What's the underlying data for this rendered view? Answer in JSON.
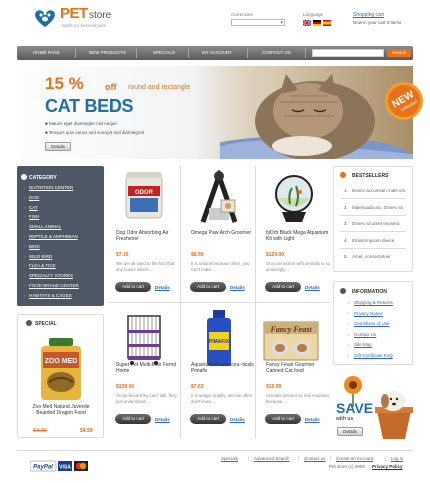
{
  "brand": {
    "pet": "PET",
    "store": "store",
    "tagline": "stuffs for beloved pets"
  },
  "header": {
    "currency_label": "Currencies",
    "currency_value": "",
    "language_label": "Language",
    "cart_title": "Shopping cart",
    "cart_text": "Now in your cart 0 items"
  },
  "nav": {
    "items": [
      "Home Page",
      "New Products",
      "Specials",
      "My Account",
      "Contact Us"
    ],
    "search_label": "Search",
    "search_placeholder": ""
  },
  "banner": {
    "percent": "15 %",
    "off": "off",
    "sub": "round and rectangle",
    "title": "CAT BEDS",
    "bullets": [
      "Mauris eget diamtegter nisl neque",
      "Tempus quis varius sed suscipit sed diamtegrtol"
    ],
    "details": "Details",
    "badge_new": "NEW",
    "badge_collection": "collection"
  },
  "categories": {
    "heading": "Category",
    "items": [
      "Nutrition Center",
      "Dog",
      "Cat",
      "Fish",
      "Small Animal",
      "Reptile & Amphibian",
      "Bird",
      "Wild Bird",
      "Flea & Tick",
      "Specialty Stores",
      "Food Brand Center",
      "Habitats & Cages"
    ]
  },
  "special": {
    "heading": "Special",
    "name": "Zoo Med Natural Juvenile Bearded Dragon Food",
    "old_price": "$ 5.99",
    "new_price": "$4.99"
  },
  "products": [
    {
      "name": "Dog Odor Absorbing Air Freshener",
      "price": "$7.19",
      "desc": "We are all used to the fact that any house where ..."
    },
    {
      "name": "Omega Paw Arch Groomer",
      "price": "$8.99",
      "desc": "It is natural because often, you can't make ..."
    },
    {
      "name": "biOrb Black Mega Aquarium Kit with Light",
      "price": "$129.00",
      "desc": "Our connection with animals is so amazingly ..."
    },
    {
      "name": "Super Pet Multi-floor Ferret Home",
      "price": "$139.00",
      "desc": "As we know they can't talk, they just understand ..."
    },
    {
      "name": "Aquarium Pharmaceu- ticals Pimafix",
      "price": "$7.63",
      "desc": "It is unique quality, and we often don't know ..."
    },
    {
      "name": "Fancy Feast Gourmet Canned Cat food",
      "price": "$12.99",
      "desc": "Animals present us real emotions because ..."
    }
  ],
  "buttons": {
    "add_to_cart": "Add to cart",
    "details": "Details"
  },
  "bestsellers": {
    "heading": "Bestsellers",
    "items": [
      "Donec accumsan male ors",
      "Malesuada arc. Donec sit",
      "Donec sit amet enosera",
      "Etosenmpsum duece",
      "Amet, consectetuer"
    ]
  },
  "information": {
    "heading": "Information",
    "items": [
      "Shipping & Returns",
      "Privacy Notice",
      "Conditions of Use",
      "Contact Us",
      "Site Map",
      "Gift Certificate FAQ"
    ]
  },
  "save": {
    "title": "SAVE",
    "sub": "with us",
    "details": "Details"
  },
  "footer": {
    "links": [
      "Specials",
      "Advanced Search",
      "Contact us",
      "Create an Account",
      "Log in"
    ],
    "copyright": "Pet store (c) 2009",
    "privacy": "Privacy Policy",
    "pay_paypal": "PayPal",
    "pay_visa": "VISA"
  },
  "colors": {
    "accent": "#e8711a",
    "blue": "#1f6fa0",
    "link": "#2a6db5",
    "dark": "#4d5766"
  }
}
